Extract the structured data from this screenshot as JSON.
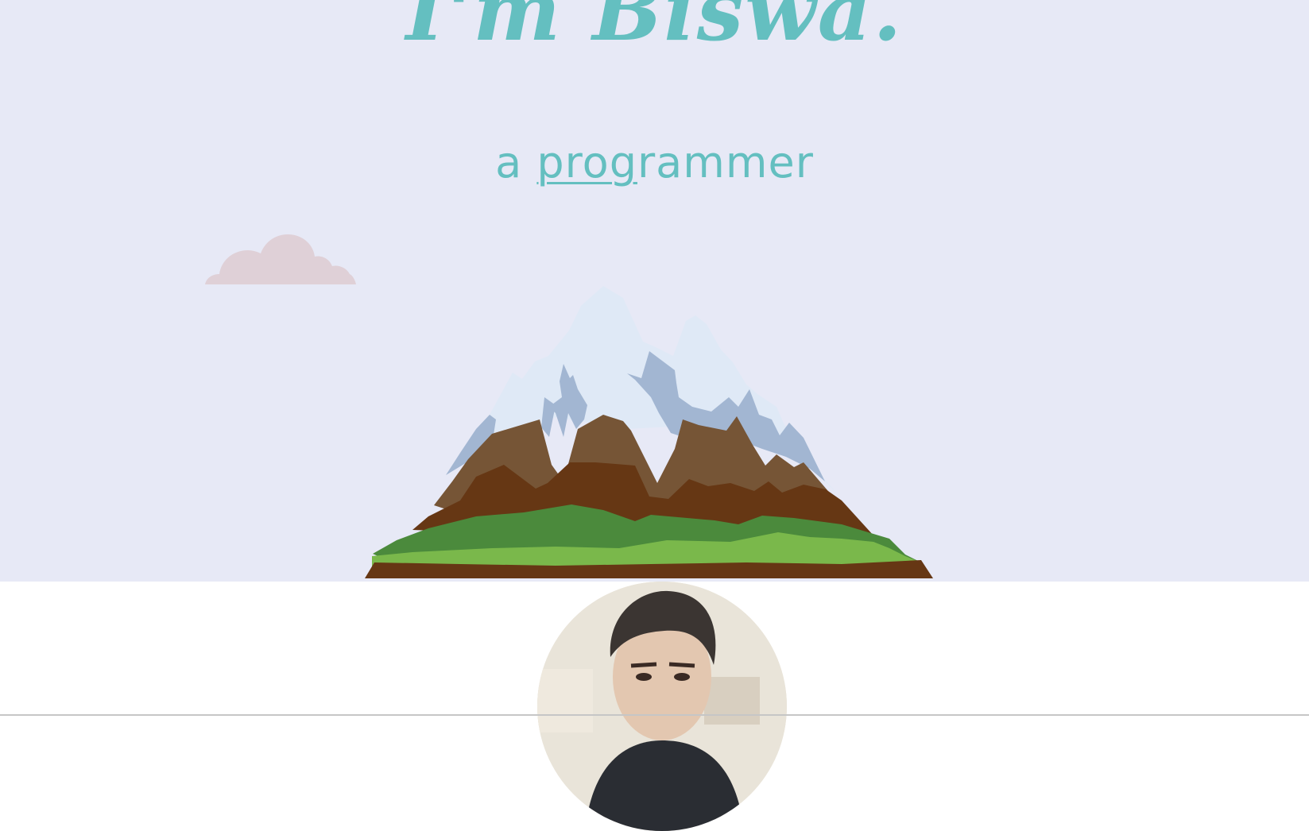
{
  "hero": {
    "title": "I'm Biswa.",
    "tagline_prefix": "a",
    "tagline_typed": "prog",
    "tagline_rest": "rammer"
  },
  "colors": {
    "hero_background": "#e7e9f6",
    "accent_teal": "#64bfc0",
    "cloud": "#dfd0d7",
    "snow": "#dfe9f6",
    "snow_shadow": "#a2b6d2",
    "rock_light": "#765536",
    "rock_dark": "#663714",
    "grass_dark": "#4b8a3c",
    "grass_light": "#7ab84b"
  },
  "icons": {
    "cloud": "cloud-illustration",
    "mountain": "mountain-illustration",
    "profile": "profile-photo"
  }
}
